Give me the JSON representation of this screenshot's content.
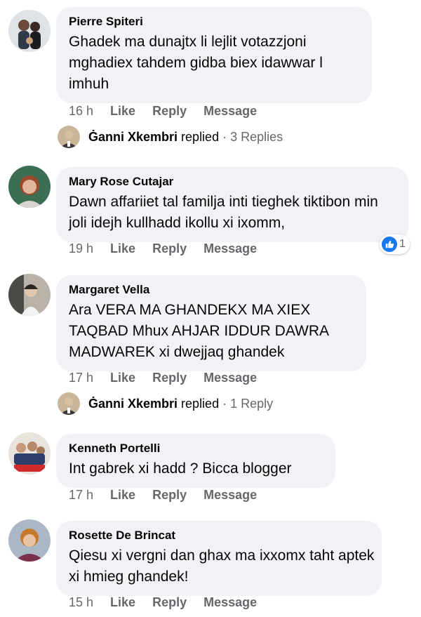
{
  "actions": {
    "like": "Like",
    "reply": "Reply",
    "message": "Message"
  },
  "comments": [
    {
      "author": "Pierre Spiteri",
      "text": "Ghadek ma dunajtx li lejlit votazzjoni mghadiex tahdem gidba biex idawwar l imhuh",
      "time": "16 h",
      "replies": {
        "name": "Ġanni Xkembri",
        "verb": "replied",
        "count": "· 3 Replies"
      }
    },
    {
      "author": "Mary Rose Cutajar",
      "text": "Dawn affariiet tal familja inti tieghek tiktibon min joli idejh kullhadd ikollu xi ixomm,",
      "time": "19 h",
      "reaction": {
        "icon": "thumbs-up-icon",
        "count": "1"
      }
    },
    {
      "author": "Margaret Vella",
      "text": "Ara VERA MA GHANDEKX MA XIEX TAQBAD Mhux AHJAR IDDUR DAWRA MADWAREK xi dwejjaq ghandek",
      "time": "17 h",
      "replies": {
        "name": "Ġanni Xkembri",
        "verb": "replied",
        "count": "· 1 Reply"
      }
    },
    {
      "author": "Kenneth Portelli",
      "text": "Int gabrek xi hadd ? Bicca blogger",
      "time": "17 h"
    },
    {
      "author": "Rosette De Brincat",
      "text": "Qiesu xi vergni dan ghax ma ixxomx taht aptek xi hmieg ghandek!",
      "time": "15 h"
    }
  ],
  "colors": {
    "bubble": "#f0f2f5",
    "meta": "#65676b",
    "like_blue": "#1877f2",
    "text": "#050505"
  }
}
